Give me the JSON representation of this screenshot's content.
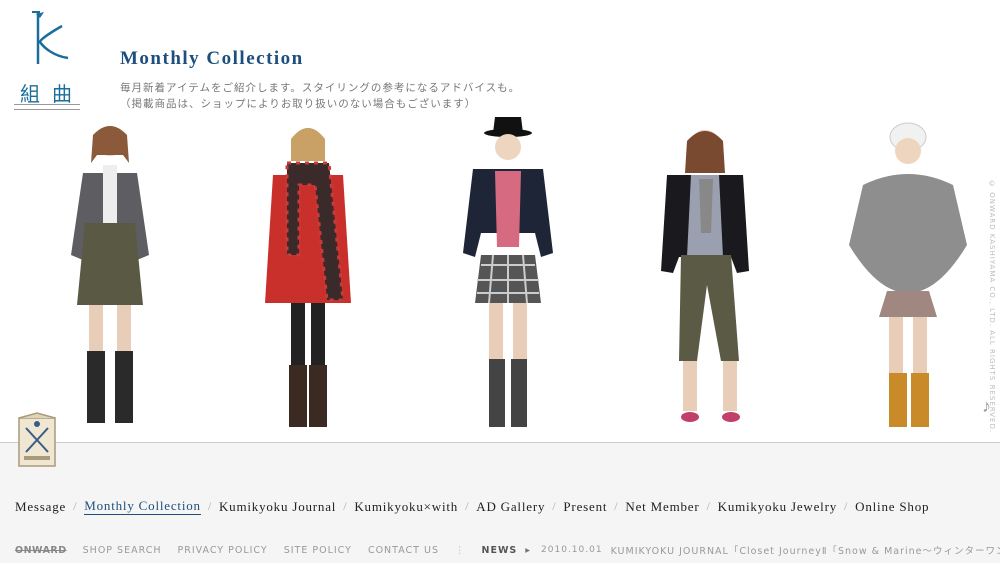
{
  "header": {
    "title": "Monthly Collection",
    "desc_line1": "毎月新着アイテムをご紹介します。スタイリングの参考になるアドバイスも。",
    "desc_line2": "（掲載商品は、ショップによりお取り扱いのない場合もございます）",
    "logo_kanji_1": "組",
    "logo_kanji_2": "曲"
  },
  "copyright": "© ONWARD KASHIYAMA CO., LTD. ALL RIGHTS RESERVED.",
  "models": [
    {
      "jacket": "#5d5d62",
      "skirt": "#5a5a44",
      "boots": "#2a2a2a",
      "hat": "none",
      "hair": "#8a5a3a"
    },
    {
      "jacket": "#c9302c",
      "skirt": "#333",
      "boots": "#3b2a22",
      "hat": "none",
      "hair": "#c9a066"
    },
    {
      "jacket": "#1e2536",
      "skirt": "#555",
      "boots": "#444",
      "hat": "#111",
      "hair": "#6b4a32"
    },
    {
      "jacket": "#1a1a1e",
      "skirt": "#5b5a45",
      "boots": "#c0406a",
      "hat": "none",
      "hair": "#7a4a30"
    },
    {
      "jacket": "#8e8e8e",
      "skirt": "#a08880",
      "boots": "#c98a2a",
      "hat": "#f1f1f1",
      "hair": "#a88860"
    }
  ],
  "nav": {
    "items": [
      "Message",
      "Monthly Collection",
      "Kumikyoku Journal",
      "Kumikyoku×with",
      "AD Gallery",
      "Present",
      "Net Member",
      "Kumikyoku Jewelry",
      "Online Shop"
    ],
    "sep": "/"
  },
  "subnav": {
    "onward": "ONWARD",
    "links": [
      "SHOP SEARCH",
      "PRIVACY POLICY",
      "SITE POLICY",
      "CONTACT US"
    ],
    "divider": "⋮",
    "news_label": "NEWS",
    "news_arrow": "▸",
    "news_date": "2010.10.01",
    "news_headline": "KUMIKYOKU JOURNAL「Closet JourneyⅡ「Snow & Marine〜ウィンターワンダーラン"
  },
  "colors": {
    "accent": "#1c4f7d",
    "logo": "#1b6e9c"
  }
}
